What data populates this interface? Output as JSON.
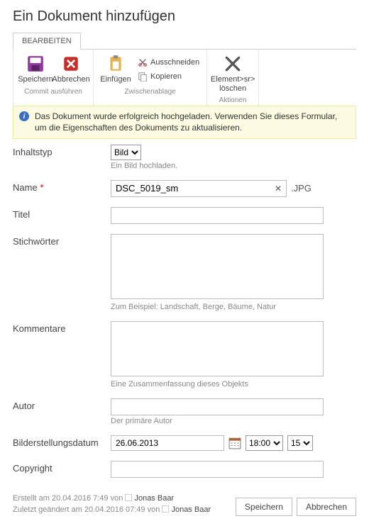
{
  "page": {
    "title": "Ein Dokument hinzufügen"
  },
  "ribbon": {
    "tab": "BEARBEITEN",
    "groups": {
      "commit": {
        "label": "Commit ausführen",
        "save": "Speichern",
        "cancel": "Abbrechen"
      },
      "clipboard": {
        "label": "Zwischenablage",
        "paste": "Einfügen",
        "cut": "Ausschneiden",
        "copy": "Kopieren"
      },
      "actions": {
        "label": "Aktionen",
        "delete": "Element>sr> löschen"
      }
    }
  },
  "notice": "Das Dokument wurde erfolgreich hochgeladen. Verwenden Sie dieses Formular, um die Eigenschaften des Dokuments zu aktualisieren.",
  "labels": {
    "contentType": "Inhaltstyp",
    "name": "Name",
    "title": "Titel",
    "keywords": "Stichwörter",
    "comments": "Kommentare",
    "author": "Autor",
    "imageDate": "Bilderstellungsdatum",
    "copyright": "Copyright"
  },
  "help": {
    "contentType": "Ein Bild hochladen.",
    "keywords": "Zum Beispiel: Landschaft, Berge, Bäume, Natur",
    "comments": "Eine Zusammenfassung dieses Objekts",
    "author": "Der primäre Autor"
  },
  "values": {
    "contentTypeSelected": "Bild",
    "name": "DSC_5019_sm",
    "nameExt": ".JPG",
    "title": "",
    "keywords": "",
    "comments": "",
    "author": "",
    "date": "26.06.2013",
    "timeHour": "18:00",
    "timeMin": "15",
    "copyright": ""
  },
  "meta": {
    "createdPrefix": "Erstellt am 20.04.2016 7:49 von",
    "modifiedPrefix": "Zuletzt geändert am 20.04.2016 07:49 von",
    "user": "Jonas Baar"
  },
  "footerButtons": {
    "save": "Speichern",
    "cancel": "Abbrechen"
  }
}
